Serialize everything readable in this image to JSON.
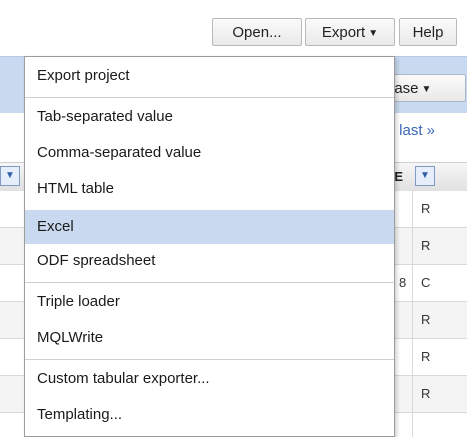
{
  "toolbar": {
    "open_label": "Open...",
    "export_label": "Export",
    "help_label": "Help"
  },
  "project_bar": {
    "database_label": "base"
  },
  "pager": {
    "last_label": "last »",
    "prefix": "›"
  },
  "columns": {
    "date_header": "ATE"
  },
  "rows": [
    {
      "suffix": "",
      "flag": "R"
    },
    {
      "suffix": "",
      "flag": "R"
    },
    {
      "suffix": "8",
      "flag": "C"
    },
    {
      "suffix": "",
      "flag": "R"
    },
    {
      "suffix": "",
      "flag": "R"
    },
    {
      "suffix": "",
      "flag": "R"
    }
  ],
  "export_menu": {
    "items": [
      "Export project",
      "Tab-separated value",
      "Comma-separated value",
      "HTML table",
      "Excel",
      "ODF spreadsheet",
      "Triple loader",
      "MQLWrite",
      "Custom tabular exporter...",
      "Templating..."
    ],
    "highlighted": "Excel"
  },
  "colors": {
    "highlight": "#c9d9ef",
    "link": "#3a68b8"
  }
}
